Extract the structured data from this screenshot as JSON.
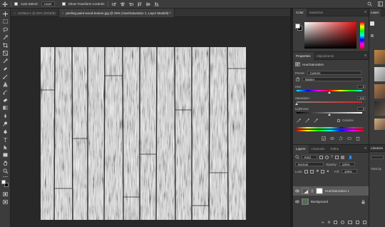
{
  "options_bar": {
    "auto_select_label": "Auto-Select:",
    "auto_select_target": "Layer",
    "show_transform_label": "Show Transform Controls"
  },
  "tabs": [
    {
      "label": "Untitled-1 @ 50% (RGB/8)",
      "active": false,
      "close": "×"
    },
    {
      "label": "peeling-paint-wood-texture.jpg @ 25% (Hue/Saturation 1, Layer Mask/8) *",
      "active": true,
      "close": "×"
    }
  ],
  "color_panel": {
    "tabs": [
      "Color",
      "Swatches"
    ],
    "foreground": "#ffffff",
    "background": "#000000",
    "selected_hue": "#e01010"
  },
  "properties_panel": {
    "tabs": [
      "Properties",
      "Adjustments"
    ],
    "header": "Hue/Saturation",
    "preset_label": "Preset:",
    "preset_value": "Custom",
    "channel_value": "Master",
    "hue_label": "Hue:",
    "hue_value": "0",
    "saturation_label": "Saturation:",
    "saturation_value": "-100",
    "lightness_label": "Lightness:",
    "lightness_value": "0",
    "colorize_label": "Colorize"
  },
  "layers_panel": {
    "tabs": [
      "Layers",
      "Channels",
      "Paths"
    ],
    "filter_label": "Kind",
    "blend_mode": "Normal",
    "opacity_label": "Opacity:",
    "opacity_value": "100%",
    "lock_label": "Lock:",
    "fill_label": "Fill:",
    "fill_value": "100%",
    "layers": [
      {
        "name": "Hue/Saturation 1",
        "selected": true
      },
      {
        "name": "Background",
        "selected": false
      }
    ]
  },
  "far_panel": {
    "tabs": [
      "Learn"
    ],
    "libraries_label": "Libraries",
    "view_label": "View by"
  },
  "colors": {
    "accent": "#2d8ceb",
    "panel_bg": "#3c3c3c",
    "app_bg": "#282828"
  }
}
